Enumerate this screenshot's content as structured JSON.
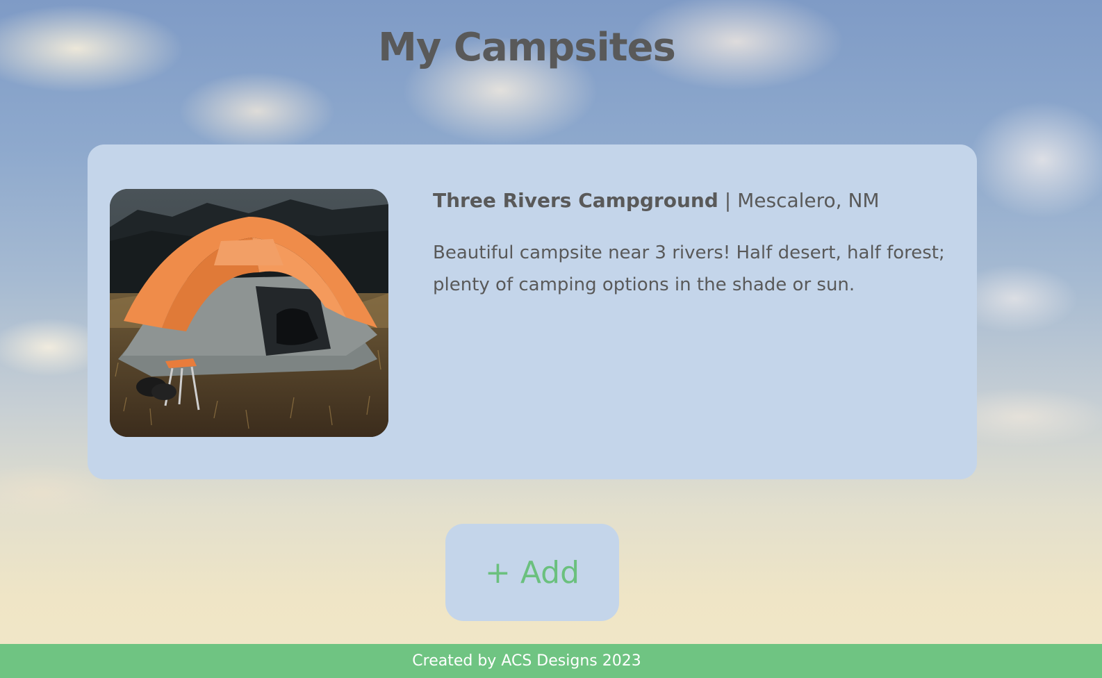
{
  "page": {
    "title": "My Campsites"
  },
  "campsites": [
    {
      "name": "Three Rivers Campground",
      "separator": "|",
      "location": "Mescalero, NM",
      "description": "Beautiful campsite near 3 rivers! Half desert, half forest; plenty of camping options in the shade or sun.",
      "image_icon": "tent-photo"
    }
  ],
  "actions": {
    "add_label": "+ Add"
  },
  "footer": {
    "text": "Created by ACS Designs 2023"
  },
  "colors": {
    "card_background": "#c4d5ea",
    "accent_green": "#6fc482",
    "text": "#595959"
  }
}
